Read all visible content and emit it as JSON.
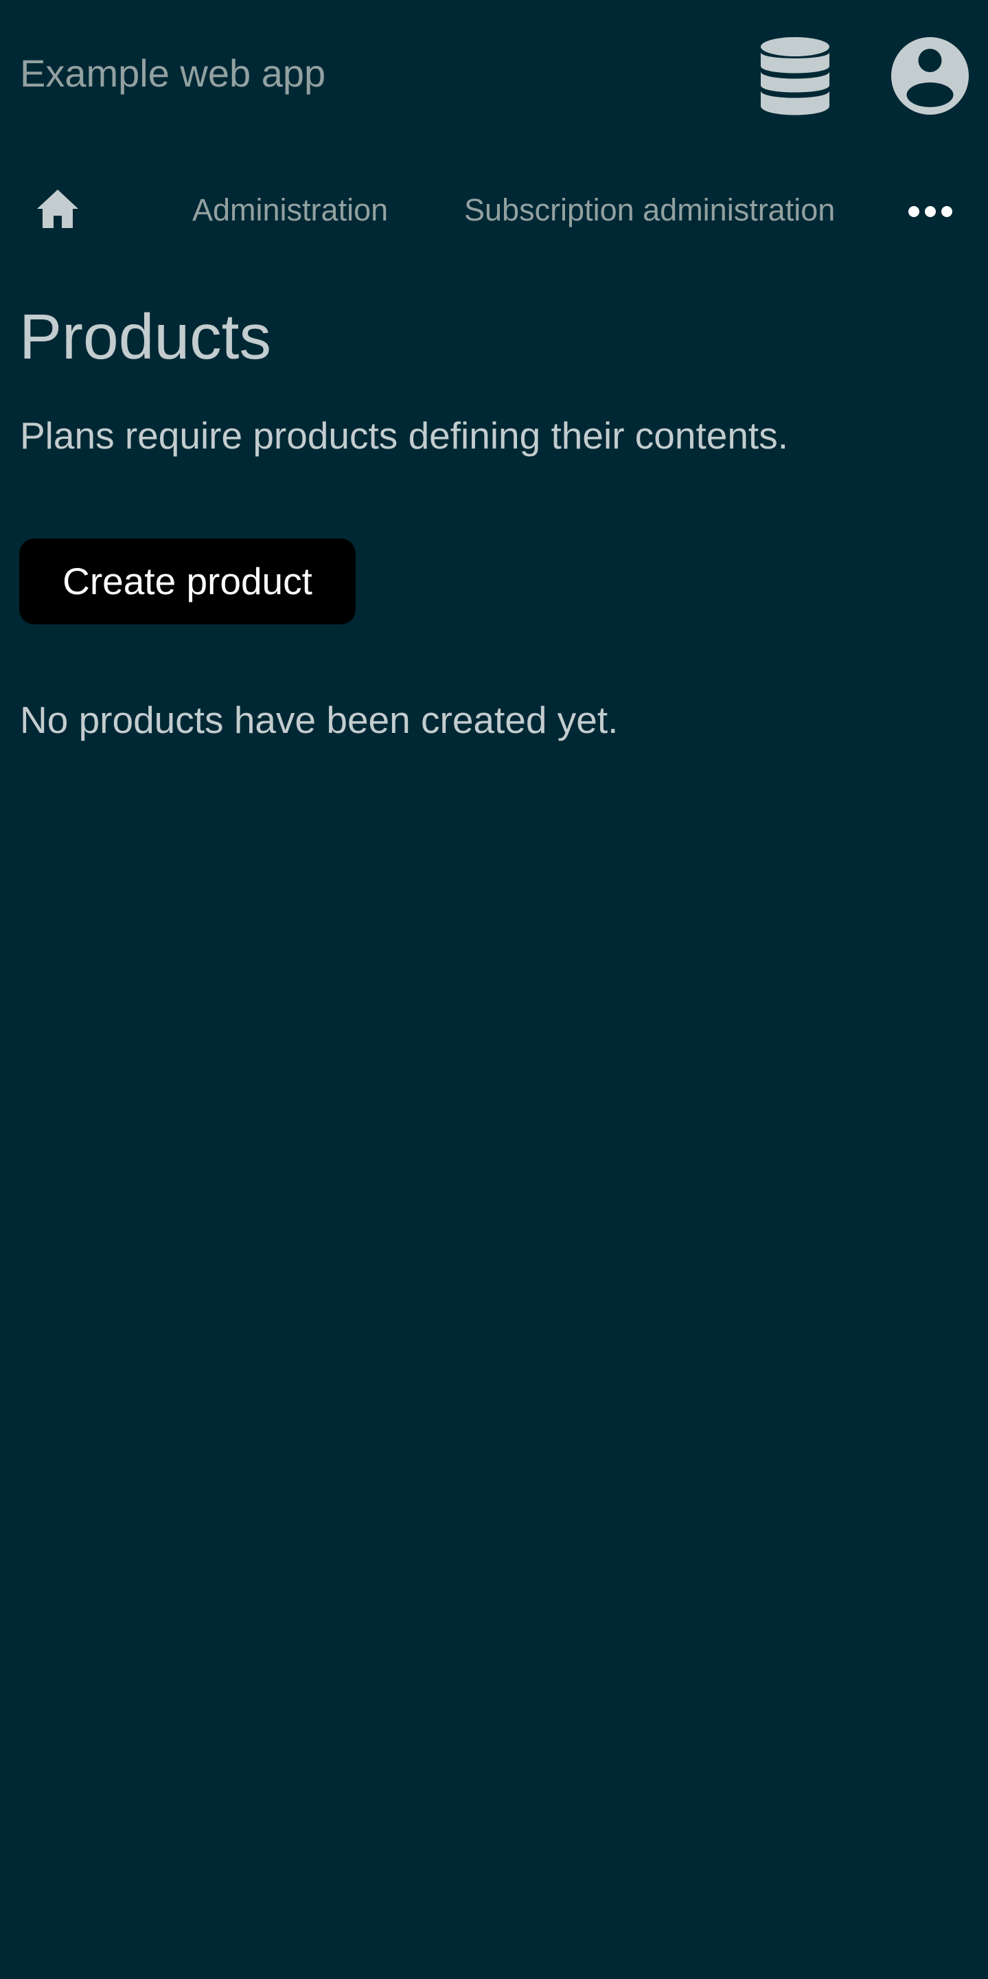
{
  "header": {
    "app_title": "Example web app",
    "icons": [
      "database-icon",
      "user-circle-icon"
    ]
  },
  "nav": {
    "home_icon": "home-icon",
    "items": [
      {
        "label": "Administration"
      },
      {
        "label": "Subscription administration"
      }
    ],
    "more_icon": "ellipsis-icon"
  },
  "main": {
    "title": "Products",
    "subtitle": "Plans require products defining their contents.",
    "create_button_label": "Create product",
    "empty_message": "No products have been created yet."
  },
  "colors": {
    "background": "#002834",
    "text_muted": "#93a1a1",
    "text_primary": "#c3ccce",
    "button_bg": "#000000",
    "button_text": "#ffffff"
  }
}
